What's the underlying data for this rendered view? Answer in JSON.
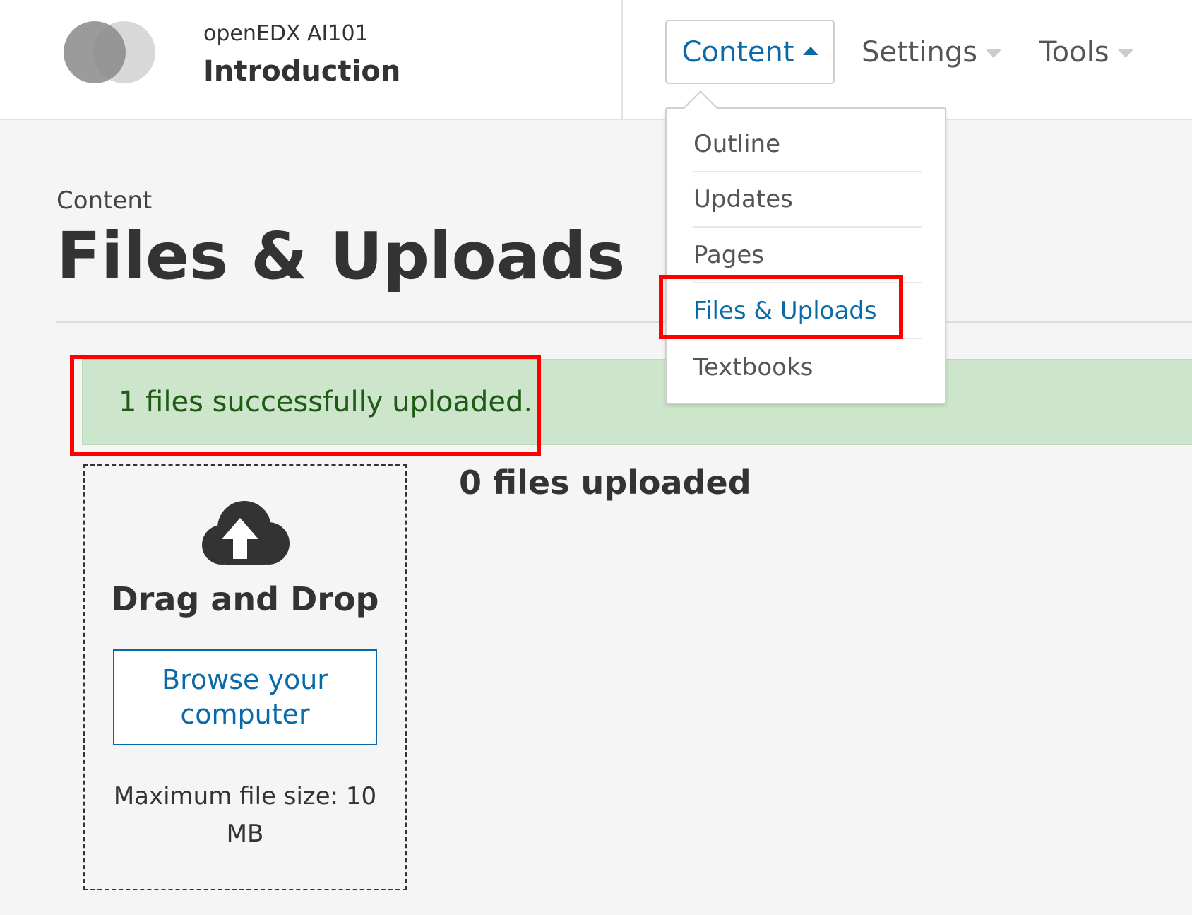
{
  "header": {
    "org": "openEDX AI101",
    "title": "Introduction",
    "logo_icon": "overlapping-circles-logo-icon"
  },
  "nav": {
    "content_label": "Content",
    "settings_label": "Settings",
    "tools_label": "Tools"
  },
  "dropdown": {
    "items": [
      {
        "label": "Outline"
      },
      {
        "label": "Updates"
      },
      {
        "label": "Pages"
      },
      {
        "label": "Files & Uploads",
        "active": true
      },
      {
        "label": "Textbooks"
      }
    ]
  },
  "page": {
    "breadcrumb": "Content",
    "title": "Files & Uploads"
  },
  "alert": {
    "message": "1 files successfully uploaded."
  },
  "dropzone": {
    "icon": "cloud-upload-icon",
    "title": "Drag and Drop",
    "browse_label": "Browse your computer",
    "max_size": "Maximum file size: 10 MB"
  },
  "files": {
    "count_label": "0 files uploaded"
  },
  "colors": {
    "accent": "#0a6aa8",
    "success_bg": "#cde6cb",
    "success_text": "#1e5b15",
    "highlight": "#ff0000"
  }
}
